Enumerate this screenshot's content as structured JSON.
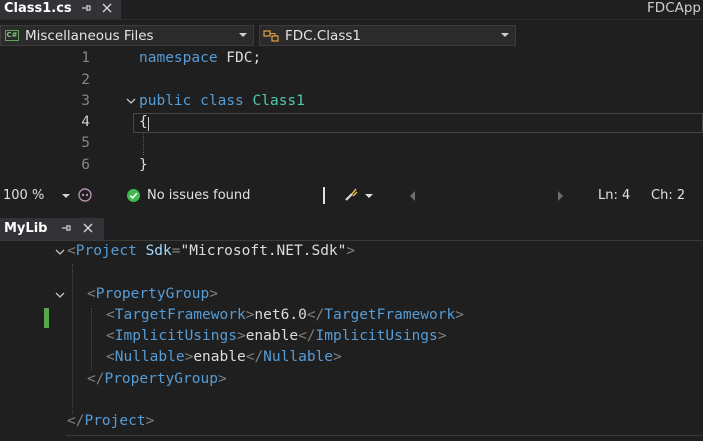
{
  "tab": {
    "filename": "Class1.cs",
    "pin": "⊳",
    "close": "✕"
  },
  "app_title": "FDCApp",
  "nav": {
    "project": "Miscellaneous Files",
    "member": "FDC.Class1"
  },
  "editor": {
    "line_numbers": [
      "1",
      "2",
      "3",
      "4",
      "5",
      "6"
    ],
    "code": {
      "l1_kw": "namespace",
      "l1_rest": " FDC;",
      "l3_kw1": "public",
      "l3_kw2": "class",
      "l3_name": "Class1",
      "l4_brace": "{",
      "l6_brace": "}"
    }
  },
  "status": {
    "zoom": "100 %",
    "issues": "No issues found",
    "line": "Ln: 4",
    "col": "Ch: 2"
  },
  "panel": {
    "title": "MyLib",
    "pin": "⊳",
    "close": "✕"
  },
  "xml": {
    "open_project": "Project",
    "sdk_attr": "Sdk",
    "sdk_val": "\"Microsoft.NET.Sdk\"",
    "property_group": "PropertyGroup",
    "tf_tag": "TargetFramework",
    "tf_val": "net6.0",
    "iu_tag": "ImplicitUsings",
    "iu_val": "enable",
    "nu_tag": "Nullable",
    "nu_val": "enable",
    "close_pg": "PropertyGroup",
    "close_project": "Project"
  },
  "colors": {
    "keyword": "#569cd6",
    "type": "#4ec9b0",
    "ok": "#3fb950",
    "change": "#57a64a"
  },
  "icons": [
    "cs-file-icon",
    "class-icon",
    "copilot-icon",
    "check-icon",
    "brush-icon"
  ]
}
